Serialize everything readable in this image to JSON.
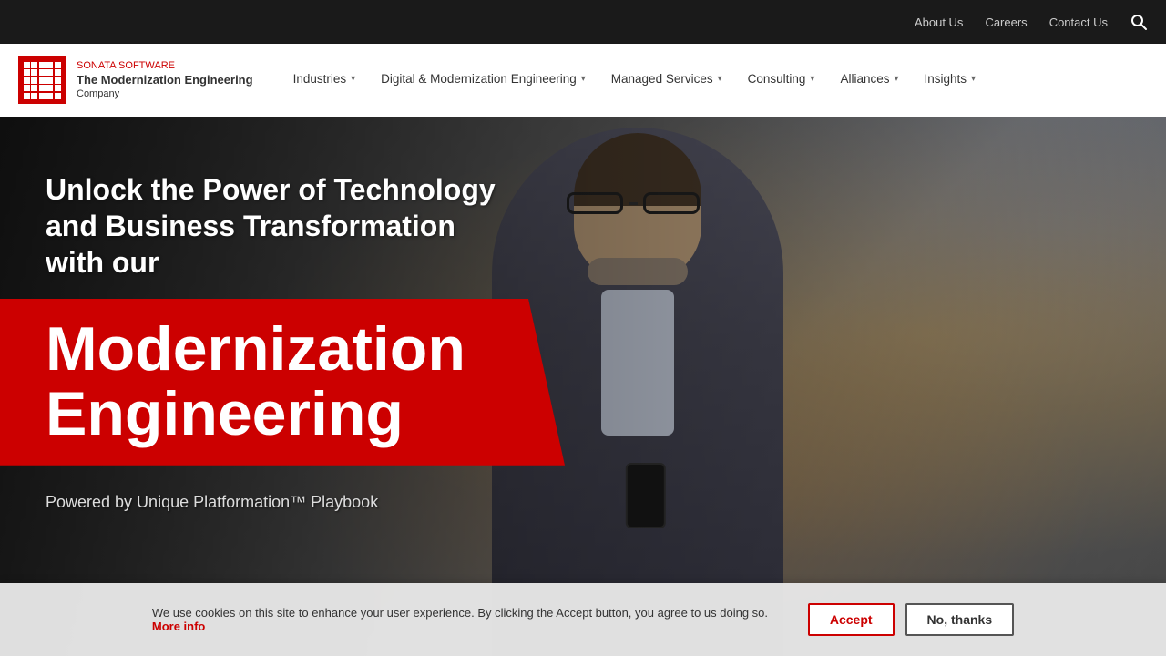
{
  "topbar": {
    "about_us": "About Us",
    "careers": "Careers",
    "contact_us": "Contact Us"
  },
  "logo": {
    "company_name": "The Modernization Engineering",
    "subtitle": "Company",
    "brand": "SONATA",
    "brand_sub": "SOFTWARE"
  },
  "nav": {
    "items": [
      {
        "label": "Industries",
        "has_dropdown": true
      },
      {
        "label": "Digital & Modernization Engineering",
        "has_dropdown": true
      },
      {
        "label": "Managed Services",
        "has_dropdown": true
      },
      {
        "label": "Consulting",
        "has_dropdown": true
      },
      {
        "label": "Alliances",
        "has_dropdown": true
      },
      {
        "label": "Insights",
        "has_dropdown": true
      }
    ]
  },
  "hero": {
    "tagline": "Unlock the Power of Technology and Business Transformation with our",
    "main_title_line1": "Modernization",
    "main_title_line2": "Engineering",
    "powered_by": "Powered by Unique Platformation™ Playbook"
  },
  "cookie": {
    "message": "We use cookies on this site to enhance your user experience. By clicking the Accept button, you agree to us doing so.",
    "more_info": "More info",
    "accept": "Accept",
    "no_thanks": "No, thanks"
  }
}
